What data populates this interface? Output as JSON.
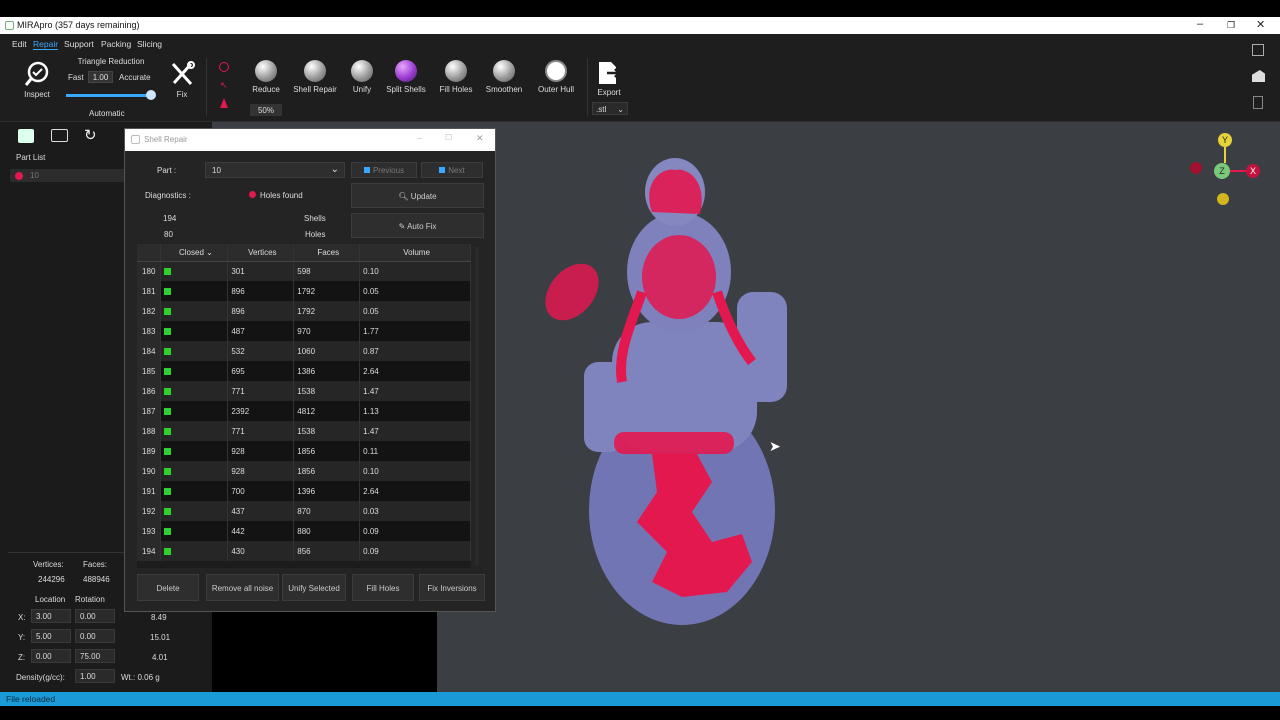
{
  "window": {
    "title": "MIRApro (357 days remaining)"
  },
  "menu": [
    "Edit",
    "Repair",
    "Support",
    "Packing",
    "Slicing"
  ],
  "ribbon": {
    "inspect": "Inspect",
    "triangle_reduction": "Triangle Reduction",
    "fast": "Fast",
    "reduction_value": "1.00",
    "accurate": "Accurate",
    "automatic": "Automatic",
    "fix": "Fix",
    "reduce": "Reduce",
    "reduce_pct": "50%",
    "shell_repair": "Shell Repair",
    "unify": "Unify",
    "split_shells": "Split Shells",
    "fill_holes": "Fill Holes",
    "smoothen": "Smoothen",
    "outer_hull": "Outer Hull",
    "export": "Export",
    "export_format": ".stl"
  },
  "left": {
    "part_list": "Part List",
    "part_item": "10",
    "vertices_label": "Vertices:",
    "faces_label": "Faces:",
    "vertices": "244296",
    "faces": "488946",
    "location": "Location",
    "rotation": "Rotation",
    "x_label": "X:",
    "y_label": "Y:",
    "z_label": "Z:",
    "loc_x": "3.00",
    "loc_y": "5.00",
    "loc_z": "0.00",
    "rot_x": "0.00",
    "rot_y": "0.00",
    "rot_z": "75.00",
    "dim_x": "8.49",
    "dim_y": "15.01",
    "dim_z": "4.01",
    "density_label": "Density(g/cc):",
    "density": "1.00",
    "weight": "Wt.: 0.06 g"
  },
  "dialog": {
    "title": "Shell Repair",
    "part_label": "Part :",
    "part_value": "10",
    "previous": "Previous",
    "next": "Next",
    "diagnostics": "Diagnostics :",
    "holes_found": "Holes found",
    "update": "Update",
    "shells_count": "194",
    "shells_label": "Shells",
    "holes_count": "80",
    "holes_label": "Holes",
    "auto_fix": "Auto Fix",
    "columns": [
      "Closed",
      "Vertices",
      "Faces",
      "Volume"
    ],
    "rows": [
      {
        "id": "180",
        "vertices": "301",
        "faces": "598",
        "volume": "0.10"
      },
      {
        "id": "181",
        "vertices": "896",
        "faces": "1792",
        "volume": "0.05"
      },
      {
        "id": "182",
        "vertices": "896",
        "faces": "1792",
        "volume": "0.05"
      },
      {
        "id": "183",
        "vertices": "487",
        "faces": "970",
        "volume": "1.77"
      },
      {
        "id": "184",
        "vertices": "532",
        "faces": "1060",
        "volume": "0.87"
      },
      {
        "id": "185",
        "vertices": "695",
        "faces": "1386",
        "volume": "2.64"
      },
      {
        "id": "186",
        "vertices": "771",
        "faces": "1538",
        "volume": "1.47"
      },
      {
        "id": "187",
        "vertices": "2392",
        "faces": "4812",
        "volume": "1.13"
      },
      {
        "id": "188",
        "vertices": "771",
        "faces": "1538",
        "volume": "1.47"
      },
      {
        "id": "189",
        "vertices": "928",
        "faces": "1856",
        "volume": "0.11"
      },
      {
        "id": "190",
        "vertices": "928",
        "faces": "1856",
        "volume": "0.10"
      },
      {
        "id": "191",
        "vertices": "700",
        "faces": "1396",
        "volume": "2.64"
      },
      {
        "id": "192",
        "vertices": "437",
        "faces": "870",
        "volume": "0.03"
      },
      {
        "id": "193",
        "vertices": "442",
        "faces": "880",
        "volume": "0.09"
      },
      {
        "id": "194",
        "vertices": "430",
        "faces": "856",
        "volume": "0.09"
      }
    ],
    "actions": [
      "Delete",
      "Remove all noise",
      "Unify Selected",
      "Fill Holes",
      "Fix Inversions"
    ]
  },
  "axes": {
    "y": "Y",
    "z": "Z",
    "x": "X"
  },
  "status": "File reloaded",
  "colors": {
    "accent": "#39a9ff",
    "status": "#1a9ad6",
    "mesh": "#8f8fd0",
    "highlight": "#e3184f"
  }
}
